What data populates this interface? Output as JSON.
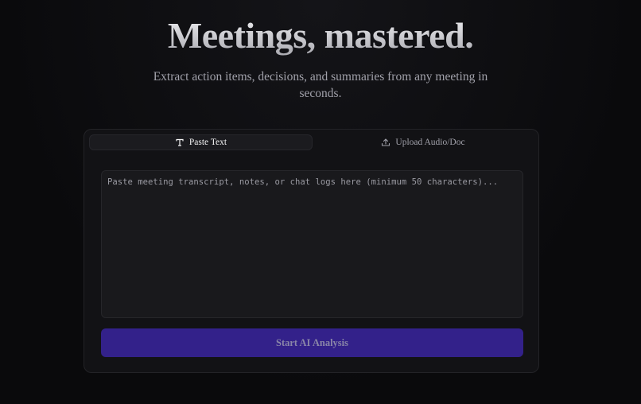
{
  "hero": {
    "title": "Meetings, mastered.",
    "subtitle": "Extract action items, decisions, and summaries from any meeting in seconds."
  },
  "tabs": [
    {
      "label": "Paste Text",
      "icon": "text-type-icon",
      "active": true
    },
    {
      "label": "Upload Audio/Doc",
      "icon": "upload-icon",
      "active": false
    }
  ],
  "input": {
    "value": "",
    "placeholder": "Paste meeting transcript, notes, or chat logs here (minimum 50 characters)..."
  },
  "actions": {
    "analyze_label": "Start AI Analysis"
  },
  "colors": {
    "background": "#0b0b0d",
    "card": "#121215",
    "button": "#33218a",
    "button_text": "#8a86a8"
  }
}
